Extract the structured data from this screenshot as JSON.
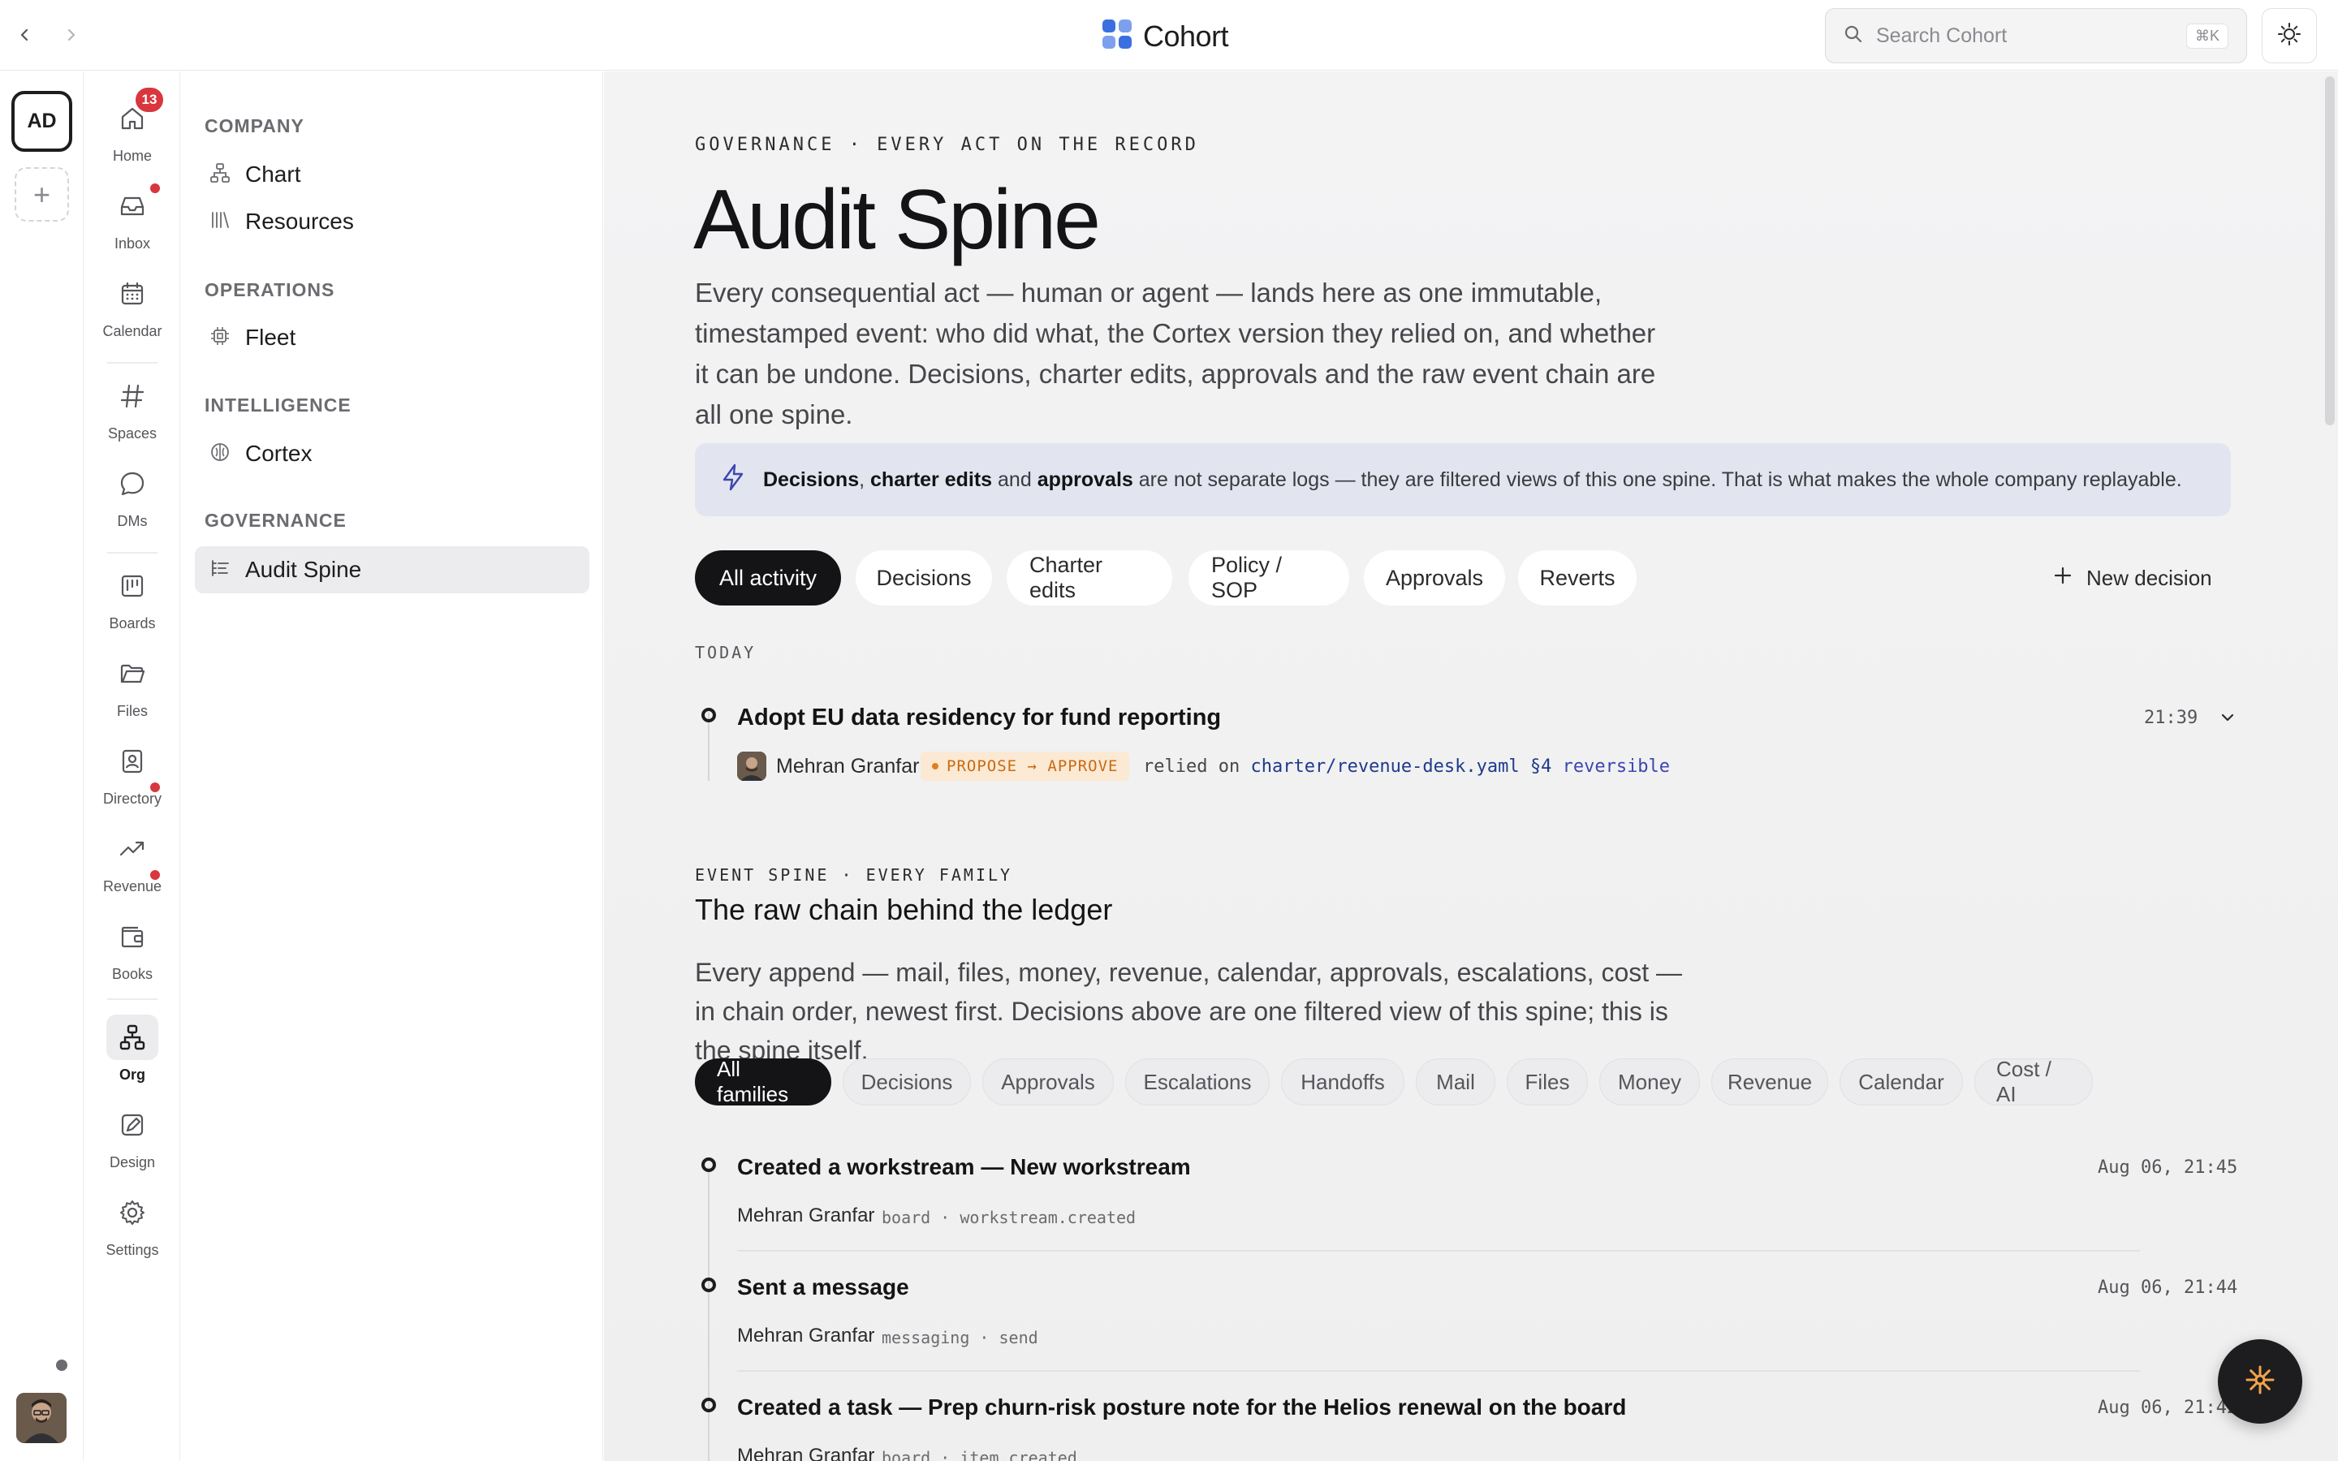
{
  "app": {
    "brand": "Cohort",
    "search_placeholder": "Search Cohort",
    "search_shortcut": "⌘K",
    "accent": "#1d4ed8",
    "brand_color": "#3b6fe0"
  },
  "workspace": {
    "initials": "AD",
    "add_label": "+"
  },
  "app_rail": [
    {
      "label": "Home",
      "icon": "home-icon",
      "badge": "13"
    },
    {
      "label": "Inbox",
      "icon": "inbox-icon",
      "dot": true
    },
    {
      "label": "Calendar",
      "icon": "calendar-icon"
    },
    {
      "label": "Spaces",
      "icon": "hash-icon"
    },
    {
      "label": "DMs",
      "icon": "chat-icon"
    },
    {
      "label": "Boards",
      "icon": "board-icon"
    },
    {
      "label": "Files",
      "icon": "folder-icon"
    },
    {
      "label": "Directory",
      "icon": "contact-icon",
      "dot": true
    },
    {
      "label": "Revenue",
      "icon": "trend-icon",
      "dot": true
    },
    {
      "label": "Books",
      "icon": "wallet-icon"
    },
    {
      "label": "Org",
      "icon": "org-icon",
      "active": true
    },
    {
      "label": "Design",
      "icon": "design-icon"
    },
    {
      "label": "Settings",
      "icon": "gear-icon"
    }
  ],
  "nav": {
    "sections": [
      {
        "heading": "COMPANY",
        "items": [
          {
            "label": "Chart",
            "icon": "org-chart-icon"
          },
          {
            "label": "Resources",
            "icon": "library-icon"
          }
        ]
      },
      {
        "heading": "OPERATIONS",
        "items": [
          {
            "label": "Fleet",
            "icon": "chip-icon"
          }
        ]
      },
      {
        "heading": "INTELLIGENCE",
        "items": [
          {
            "label": "Cortex",
            "icon": "brain-icon"
          }
        ]
      },
      {
        "heading": "GOVERNANCE",
        "items": [
          {
            "label": "Audit Spine",
            "icon": "list-icon",
            "active": true
          }
        ]
      }
    ]
  },
  "page": {
    "eyebrow": "GOVERNANCE · EVERY ACT ON THE RECORD",
    "title": "Audit Spine",
    "lede": "Every consequential act — human or agent — lands here as one immutable, timestamped event: who did what, the Cortex version they relied on, and whether it can be undone. Decisions, charter edits, approvals and the raw event chain are all one spine.",
    "callout": {
      "bold_1": "Decisions",
      "sep_1": ", ",
      "bold_2": "charter edits",
      "sep_2": " and ",
      "bold_3": "approvals",
      "rest": " are not separate logs — they are filtered views of this one spine. That is what makes the whole company replayable."
    },
    "filters": [
      "All activity",
      "Decisions",
      "Charter edits",
      "Policy / SOP",
      "Approvals",
      "Reverts"
    ],
    "new_decision_label": "New decision",
    "today_label": "TODAY",
    "today_event": {
      "title": "Adopt EU data residency for fund reporting",
      "time": "21:39",
      "person": "Mehran Granfar",
      "tag": "PROPOSE → APPROVE",
      "relied_prefix": "relied on",
      "relied_link": "charter/revenue-desk.yaml §4",
      "reversible": "reversible"
    },
    "spine": {
      "eyebrow": "EVENT SPINE · EVERY FAMILY",
      "title": "The raw chain behind the ledger",
      "lede": "Every append — mail, files, money, revenue, calendar, approvals, escalations, cost — in chain order, newest first. Decisions above are one filtered view of this spine; this is the spine itself.",
      "families": [
        "All families",
        "Decisions",
        "Approvals",
        "Escalations",
        "Handoffs",
        "Mail",
        "Files",
        "Money",
        "Revenue",
        "Calendar",
        "Cost / AI"
      ],
      "events": [
        {
          "title": "Created a workstream — New workstream",
          "time": "Aug 06, 21:45",
          "person": "Mehran Granfar",
          "meta": "board · workstream.created"
        },
        {
          "title": "Sent a message",
          "time": "Aug 06, 21:44",
          "person": "Mehran Granfar",
          "meta": "messaging · send"
        },
        {
          "title": "Created a task — Prep churn-risk posture note for the Helios renewal on the board",
          "time": "Aug 06, 21:42",
          "person": "Mehran Granfar",
          "meta": "board · item.created"
        }
      ]
    }
  }
}
